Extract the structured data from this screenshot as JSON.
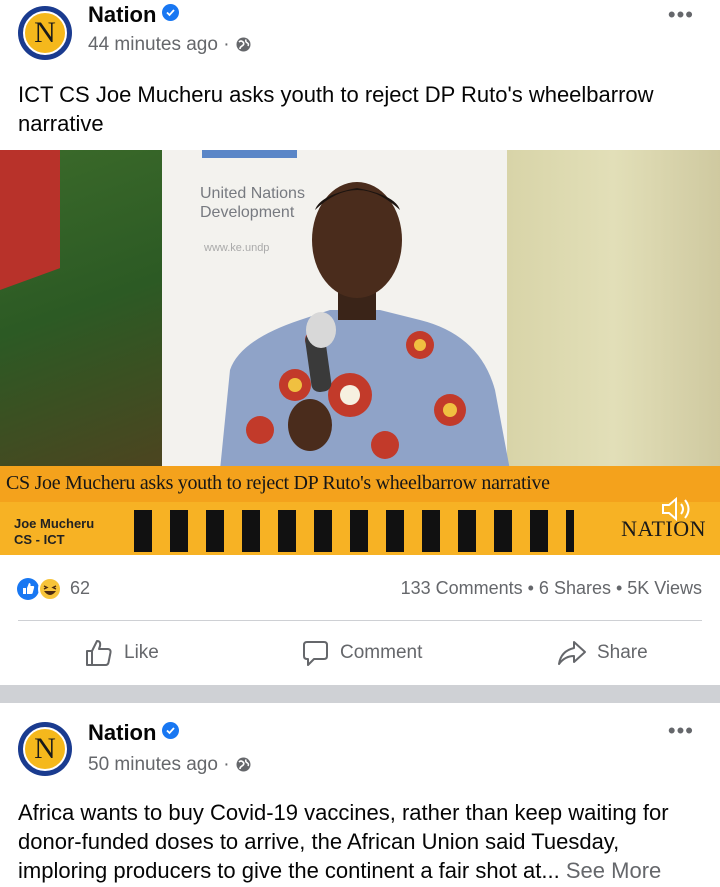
{
  "post1": {
    "page_name": "Nation",
    "avatar_letter": "N",
    "time": "44 minutes ago",
    "text": "ICT CS Joe Mucheru asks youth to reject DP Ruto's wheelbarrow narrative",
    "video": {
      "banner_line1": "United Nations",
      "banner_line2": "Development",
      "banner_url": "www.ke.undp",
      "headline": "CS Joe Mucheru asks youth to reject DP Ruto's wheelbarrow narrative",
      "name_line1": "Joe Mucheru",
      "name_line2": "CS - ICT",
      "brand": "NATION"
    },
    "reactions_count": "62",
    "stats": "133 Comments • 6 Shares • 5K Views",
    "actions": {
      "like": "Like",
      "comment": "Comment",
      "share": "Share"
    }
  },
  "post2": {
    "page_name": "Nation",
    "avatar_letter": "N",
    "time": "50 minutes ago",
    "text": "Africa wants to buy Covid-19 vaccines, rather than keep waiting for donor-funded doses to arrive, the African Union said Tuesday, imploring producers to give the continent a fair shot at...",
    "see_more": "See More"
  },
  "icons": [
    "verified-icon",
    "globe-icon",
    "more-options-icon",
    "like-reaction-icon",
    "haha-reaction-icon",
    "like-icon",
    "comment-icon",
    "share-icon",
    "speaker-icon"
  ],
  "colors": {
    "brand_blue": "#1877f2",
    "secondary_text": "#65676b",
    "lower_third": "#f4a21c"
  }
}
